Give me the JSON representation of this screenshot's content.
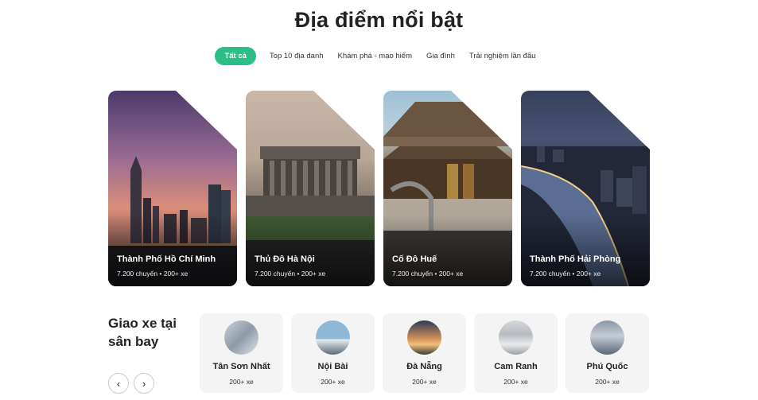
{
  "title": "Địa điểm nổi bật",
  "tabs": [
    {
      "label": "Tất cả",
      "active": true
    },
    {
      "label": "Top 10 địa danh",
      "active": false
    },
    {
      "label": "Khám phá - mạo hiểm",
      "active": false
    },
    {
      "label": "Gia đình",
      "active": false
    },
    {
      "label": "Trải nghiệm lần đầu",
      "active": false
    }
  ],
  "destinations": [
    {
      "name": "Thành Phố Hồ Chí Minh",
      "trips": "7.200 chuyến",
      "cars": "200+ xe"
    },
    {
      "name": "Thủ Đô Hà Nội",
      "trips": "7.200 chuyến",
      "cars": "200+ xe"
    },
    {
      "name": "Cố Đô Huế",
      "trips": "7.200 chuyến",
      "cars": "200+ xe"
    },
    {
      "name": "Thành Phố Hải Phòng",
      "trips": "7.200 chuyến",
      "cars": "200+ xe"
    }
  ],
  "airport_section": {
    "title_line1": "Giao xe tại",
    "title_line2": "sân bay",
    "prev_icon": "‹",
    "next_icon": "›"
  },
  "airports": [
    {
      "name": "Tân Sơn Nhất",
      "count": "200+ xe"
    },
    {
      "name": "Nội Bài",
      "count": "200+ xe"
    },
    {
      "name": "Đà Nẵng",
      "count": "200+ xe"
    },
    {
      "name": "Cam Ranh",
      "count": "200+ xe"
    },
    {
      "name": "Phú Quốc",
      "count": "200+ xe"
    }
  ],
  "colors": {
    "accent": "#2bbf87",
    "airport_bg": "#f4f4f4"
  }
}
